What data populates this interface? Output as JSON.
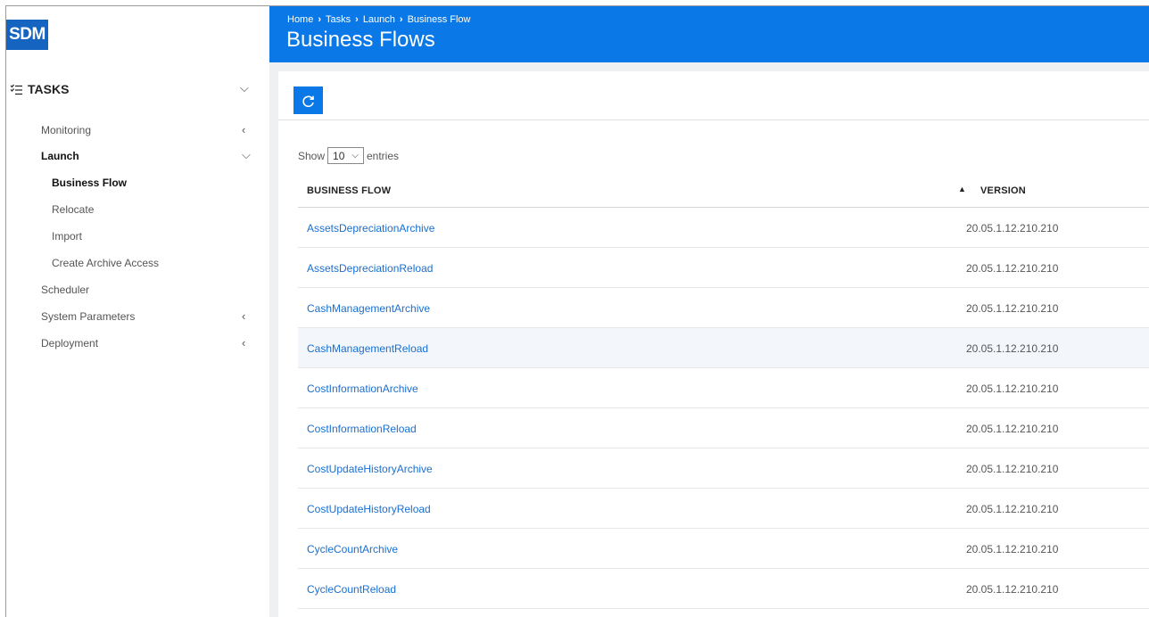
{
  "logo": "SDM",
  "breadcrumb": [
    "Home",
    "Tasks",
    "Launch",
    "Business Flow"
  ],
  "page_title": "Business Flows",
  "sidebar": {
    "section": "TASKS",
    "items": [
      {
        "label": "Monitoring"
      },
      {
        "label": "Launch"
      },
      {
        "label": "Business Flow"
      },
      {
        "label": "Relocate"
      },
      {
        "label": "Import"
      },
      {
        "label": "Create Archive Access"
      },
      {
        "label": "Scheduler"
      },
      {
        "label": "System Parameters"
      },
      {
        "label": "Deployment"
      }
    ]
  },
  "table": {
    "show_label": "Show",
    "entries_value": "10",
    "entries_label": "entries",
    "columns": [
      "BUSINESS FLOW",
      "VERSION"
    ],
    "rows": [
      {
        "flow": "AssetsDepreciationArchive",
        "version": "20.05.1.12.210.210"
      },
      {
        "flow": "AssetsDepreciationReload",
        "version": "20.05.1.12.210.210"
      },
      {
        "flow": "CashManagementArchive",
        "version": "20.05.1.12.210.210"
      },
      {
        "flow": "CashManagementReload",
        "version": "20.05.1.12.210.210"
      },
      {
        "flow": "CostInformationArchive",
        "version": "20.05.1.12.210.210"
      },
      {
        "flow": "CostInformationReload",
        "version": "20.05.1.12.210.210"
      },
      {
        "flow": "CostUpdateHistoryArchive",
        "version": "20.05.1.12.210.210"
      },
      {
        "flow": "CostUpdateHistoryReload",
        "version": "20.05.1.12.210.210"
      },
      {
        "flow": "CycleCountArchive",
        "version": "20.05.1.12.210.210"
      },
      {
        "flow": "CycleCountReload",
        "version": "20.05.1.12.210.210"
      }
    ]
  },
  "colors": {
    "accent": "#0a78e6",
    "link": "#1a6fd0",
    "logo_bg": "#1565c0"
  }
}
